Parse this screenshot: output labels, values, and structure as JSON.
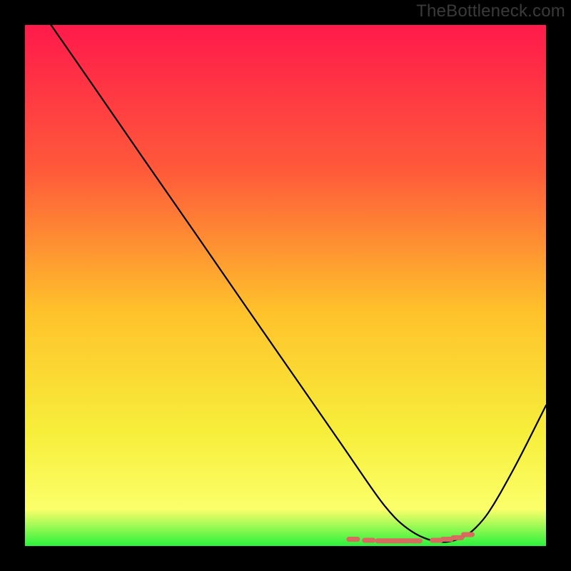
{
  "watermark": "TheBottleneck.com",
  "colors": {
    "bg": "#000000",
    "grad_top": "#ff1a4b",
    "grad_q1": "#ff5a3a",
    "grad_mid": "#ffc22b",
    "grad_q3": "#f7ee3a",
    "grad_low": "#fbff6a",
    "grad_bot": "#2cf23c",
    "curve": "#000000",
    "marker": "#d96a5f",
    "watermark": "#3a3a3a"
  },
  "chart_data": {
    "type": "line",
    "title": "",
    "xlabel": "",
    "ylabel": "",
    "xlim": [
      0,
      100
    ],
    "ylim": [
      0,
      100
    ],
    "axes_visible": false,
    "grid": false,
    "series": [
      {
        "name": "bottleneck-curve",
        "x": [
          5,
          10,
          15,
          20,
          25,
          30,
          35,
          40,
          45,
          50,
          55,
          60,
          62,
          65,
          68,
          70,
          72,
          75,
          78,
          80,
          82,
          85,
          88,
          90,
          92,
          95,
          100
        ],
        "y": [
          100,
          92.8,
          85.6,
          78.3,
          71.1,
          63.9,
          56.7,
          49.4,
          42.2,
          35.0,
          27.8,
          20.6,
          17.7,
          13.3,
          9.0,
          6.5,
          4.4,
          2.2,
          1.0,
          0.7,
          0.9,
          2.0,
          5.0,
          8.0,
          11.5,
          17.0,
          27.0
        ]
      }
    ],
    "markers": {
      "name": "highlight-dots",
      "x": [
        63,
        66,
        68.5,
        70,
        71.5,
        73,
        75,
        79,
        81,
        83,
        85
      ],
      "y": [
        1.3,
        1.1,
        1.0,
        1.0,
        1.0,
        1.0,
        1.0,
        1.1,
        1.3,
        1.6,
        2.2
      ]
    }
  }
}
